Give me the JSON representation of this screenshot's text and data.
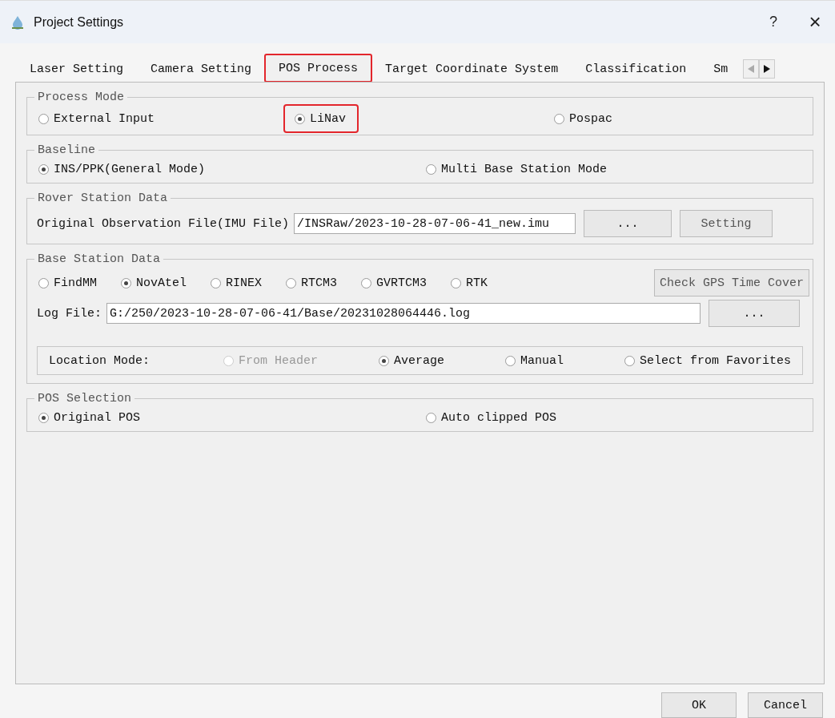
{
  "window": {
    "title": "Project Settings",
    "help": "?",
    "close": "×"
  },
  "tabs": [
    {
      "label": "Laser Setting",
      "selected": false,
      "highlighted": false
    },
    {
      "label": "Camera Setting",
      "selected": false,
      "highlighted": false
    },
    {
      "label": "POS Process",
      "selected": true,
      "highlighted": true
    },
    {
      "label": "Target Coordinate System",
      "selected": false,
      "highlighted": false
    },
    {
      "label": "Classification",
      "selected": false,
      "highlighted": false
    },
    {
      "label": "Sm",
      "selected": false,
      "highlighted": false
    }
  ],
  "process_mode": {
    "title": "Process Mode",
    "options": [
      {
        "label": "External Input",
        "selected": false,
        "highlighted": false
      },
      {
        "label": "LiNav",
        "selected": true,
        "highlighted": true
      },
      {
        "label": "Pospac",
        "selected": false,
        "highlighted": false
      }
    ]
  },
  "baseline": {
    "title": "Baseline",
    "options": [
      {
        "label": "INS/PPK(General Mode)",
        "selected": true,
        "highlighted": false
      },
      {
        "label": "Multi Base Station  Mode",
        "selected": false,
        "highlighted": false
      }
    ]
  },
  "rover": {
    "title": "Rover Station Data",
    "label": "Original Observation File(IMU File)",
    "value": "/INSRaw/2023-10-28-07-06-41_new.imu",
    "browse": "...",
    "setting": "Setting"
  },
  "base_station": {
    "title": "Base Station Data",
    "formats": [
      {
        "label": "FindMM",
        "selected": false
      },
      {
        "label": "NovAtel",
        "selected": true
      },
      {
        "label": "RINEX",
        "selected": false
      },
      {
        "label": "RTCM3",
        "selected": false
      },
      {
        "label": "GVRTCM3",
        "selected": false
      },
      {
        "label": "RTK",
        "selected": false
      }
    ],
    "check_button": "Check GPS Time Cover",
    "log_label": "Log File:",
    "log_value": "G:/250/2023-10-28-07-06-41/Base/20231028064446.log",
    "browse": "...",
    "location_label": "Location Mode:",
    "location_options": [
      {
        "label": "From Header",
        "selected": false,
        "disabled": true
      },
      {
        "label": "Average",
        "selected": true,
        "disabled": false
      },
      {
        "label": "Manual",
        "selected": false,
        "disabled": false
      },
      {
        "label": "Select from Favorites",
        "selected": false,
        "disabled": false
      }
    ]
  },
  "pos_selection": {
    "title": "POS Selection",
    "options": [
      {
        "label": "Original POS",
        "selected": true,
        "highlighted": false
      },
      {
        "label": "Auto clipped POS",
        "selected": false,
        "highlighted": false
      }
    ]
  },
  "buttons": [
    "OK",
    "Cancel"
  ]
}
